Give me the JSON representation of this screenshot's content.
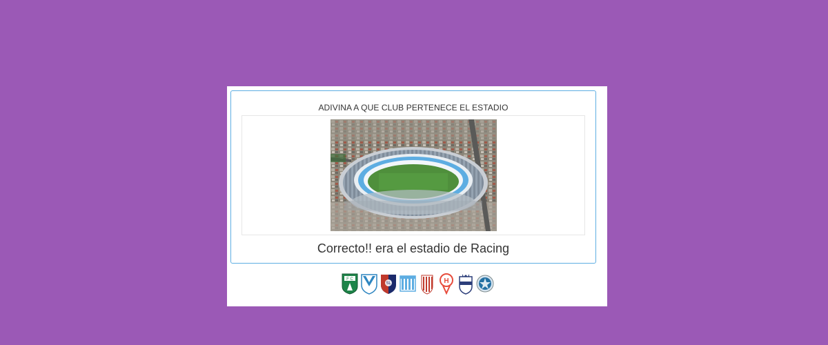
{
  "game": {
    "question": "ADIVINA A QUE CLUB PERTENECE EL ESTADIO",
    "result": "Correcto!! era el estadio de Racing",
    "stadium_image": "stadium-aerial-photo"
  },
  "clubs": [
    {
      "icon": "ferro-crest-icon",
      "color": "#1e8449"
    },
    {
      "icon": "velez-crest-icon",
      "color": "#2e86c1"
    },
    {
      "icon": "san-lorenzo-crest-icon",
      "color": "#1b2a6b"
    },
    {
      "icon": "racing-crest-icon",
      "color": "#5dade2"
    },
    {
      "icon": "barracas-crest-icon",
      "color": "#c0392b"
    },
    {
      "icon": "huracan-crest-icon",
      "color": "#e74c3c"
    },
    {
      "icon": "gimnasia-crest-icon",
      "color": "#2c3e7a"
    },
    {
      "icon": "godoy-cruz-crest-icon",
      "color": "#2471a3"
    }
  ]
}
